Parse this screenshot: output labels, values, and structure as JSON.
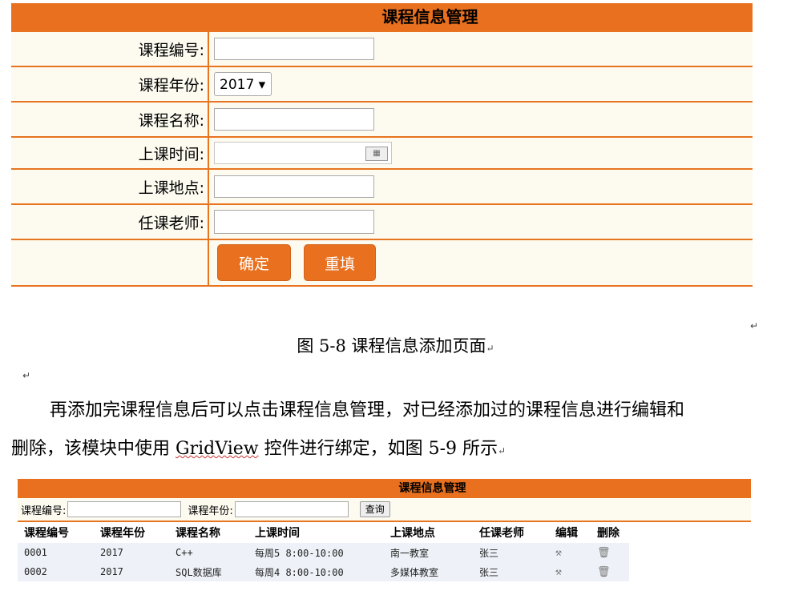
{
  "form": {
    "title": "课程信息管理",
    "fields": {
      "course_no": "课程编号:",
      "course_year": "课程年份:",
      "course_name": "课程名称:",
      "class_time": "上课时间:",
      "class_place": "上课地点:",
      "teacher": "任课老师:"
    },
    "year_value": "2017 ▾",
    "buttons": {
      "confirm": "确定",
      "reset": "重填"
    }
  },
  "caption": "图 5-8 课程信息添加页面",
  "paragraph": {
    "line1": "再添加完课程信息后可以点击课程信息管理，对已经添加过的课程信息进行编辑和",
    "line2_pre": "删除，该模块中使用 ",
    "line2_gv": "GridView",
    "line2_post": " 控件进行绑定，如图 5-9 所示"
  },
  "grid": {
    "title": "课程信息管理",
    "search": {
      "no_label": "课程编号:",
      "year_label": "课程年份:",
      "query": "查询"
    },
    "headers": [
      "课程编号",
      "课程年份",
      "课程名称",
      "上课时间",
      "上课地点",
      "任课老师",
      "编辑",
      "删除"
    ],
    "rows": [
      [
        "0001",
        "2017",
        "C++",
        "每周5 8:00-10:00",
        "南一教室",
        "张三"
      ],
      [
        "0002",
        "2017",
        "SQL数据库",
        "每周4 8:00-10:00",
        "多媒体教室",
        "张三"
      ]
    ]
  },
  "icons": {
    "edit": "wrench-icon",
    "delete": "trash-icon",
    "calendar": "calendar-icon"
  },
  "colors": {
    "accent": "#e8701e",
    "row_bg": "#fdfaf0"
  }
}
